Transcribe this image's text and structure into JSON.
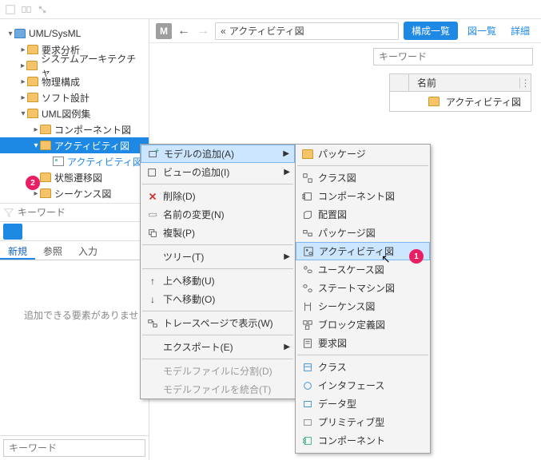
{
  "tree": {
    "root": "UML/SysML",
    "n1": "要求分析",
    "n2": "システムアーキテクチャ",
    "n3": "物理構成",
    "n4": "ソフト設計",
    "n5": "UML図例集",
    "n5a": "コンポーネント図",
    "n5b": "アクティビティ図",
    "n5b1": "アクティビティ図",
    "n5c": "状態遷移図",
    "n5d": "シーケンス図"
  },
  "filter": {
    "placeholder": "キーワード"
  },
  "tabs": {
    "t1": "新規",
    "t2": "参照",
    "t3": "入力"
  },
  "emptyMsg": "追加できる要素がありませ",
  "bottomSearch": {
    "placeholder": "キーワード"
  },
  "header": {
    "m": "M",
    "crumbPrefix": "«",
    "crumb": "アクティビティ図",
    "btn1": "構成一覧",
    "btn2": "図一覧",
    "btn3": "詳細"
  },
  "searchRight": {
    "placeholder": "キーワード"
  },
  "table": {
    "header": "名前",
    "row1": "アクティビティ図"
  },
  "ctx": {
    "addModel": "モデルの追加(A)",
    "addView": "ビューの追加(I)",
    "delete": "削除(D)",
    "rename": "名前の変更(N)",
    "dup": "複製(P)",
    "tree": "ツリー(T)",
    "moveUp": "上へ移動(U)",
    "moveDown": "下へ移動(O)",
    "tracePage": "トレースページで表示(W)",
    "export": "エクスポート(E)",
    "split": "モデルファイルに分割(D)",
    "merge": "モデルファイルを統合(T)"
  },
  "sub": {
    "package": "パッケージ",
    "classD": "クラス図",
    "componentD": "コンポーネント図",
    "deployD": "配置図",
    "packageD": "パッケージ図",
    "activityD": "アクティビティ図",
    "usecaseD": "ユースケース図",
    "statemachineD": "ステートマシン図",
    "sequenceD": "シーケンス図",
    "blockD": "ブロック定義図",
    "reqD": "要求図",
    "class": "クラス",
    "interface": "インタフェース",
    "datatype": "データ型",
    "primitive": "プリミティブ型",
    "component": "コンポーネント"
  },
  "badges": {
    "b1": "1",
    "b2": "2"
  }
}
